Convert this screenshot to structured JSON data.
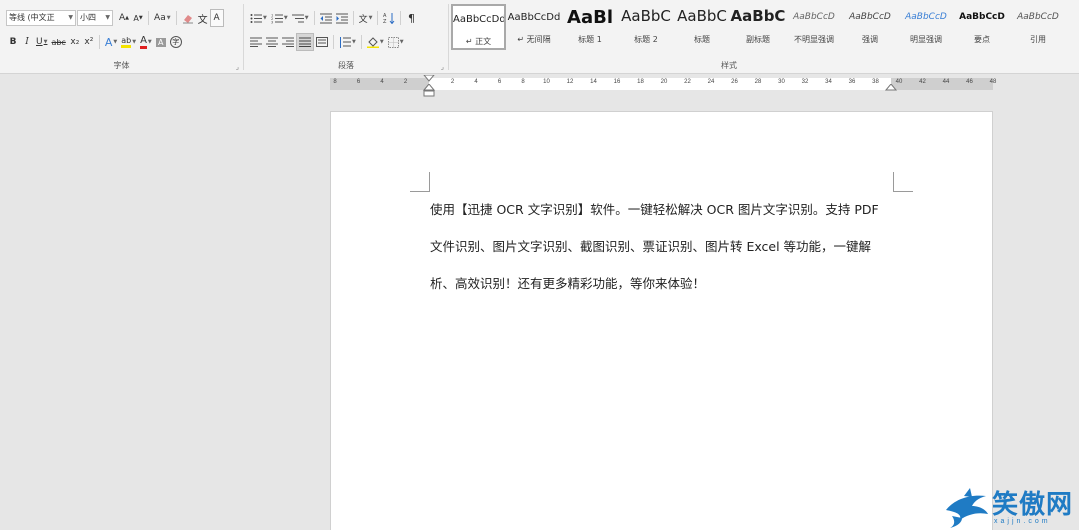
{
  "ribbon": {
    "font_group": {
      "label": "字体",
      "font_name": "等线 (中文正",
      "font_size": "小四",
      "grow_label": "A",
      "shrink_label": "A",
      "case_label": "Aa",
      "bold_label": "B",
      "italic_label": "I",
      "underline_label": "U",
      "strike_label": "abc",
      "subscript_label": "x₂",
      "superscript_label": "x²",
      "text_effect_label": "A",
      "highlight_label": "ab",
      "font_color_label": "A",
      "char_shading_label": "A",
      "enclose_label": "字",
      "phonetic_label": "文",
      "border_label": "A"
    },
    "paragraph_group": {
      "label": "段落"
    },
    "styles_group": {
      "label": "样式",
      "items": [
        {
          "preview": "AaBbCcDd",
          "name": "↵ 正文"
        },
        {
          "preview": "AaBbCcDd",
          "name": "↵ 无间隔"
        },
        {
          "preview": "AaBl",
          "name": "标题 1"
        },
        {
          "preview": "AaBbC",
          "name": "标题 2"
        },
        {
          "preview": "AaBbC",
          "name": "标题"
        },
        {
          "preview": "AaBbC",
          "name": "副标题"
        },
        {
          "preview": "AaBbCcD",
          "name": "不明显强调"
        },
        {
          "preview": "AaBbCcD",
          "name": "强调"
        },
        {
          "preview": "AaBbCcD",
          "name": "明显强调"
        },
        {
          "preview": "AaBbCcD",
          "name": "要点"
        },
        {
          "preview": "AaBbCcD",
          "name": "引用"
        }
      ]
    }
  },
  "ruler": {
    "ticks": [
      "8",
      "6",
      "4",
      "2",
      "2",
      "4",
      "6",
      "8",
      "10",
      "12",
      "14",
      "16",
      "18",
      "20",
      "22",
      "24",
      "26",
      "28",
      "30",
      "32",
      "34",
      "36",
      "38",
      "40",
      "42",
      "44",
      "46",
      "48"
    ]
  },
  "document": {
    "lines": [
      "使用【迅捷 OCR 文字识别】软件。一键轻松解决 OCR 图片文字识别。支持 PDF",
      "文件识别、图片文字识别、截图识别、票证识别、图片转 Excel 等功能，一键解",
      "析、高效识别！还有更多精彩功能，等你来体验！"
    ]
  },
  "watermark": {
    "text": "笑傲网",
    "url": "xajjn.com"
  },
  "colors": {
    "accent": "#1f7bc4",
    "ribbon_bg": "#f3f3f3",
    "workspace_bg": "#e6e6e6",
    "font_color_underline": "#e02020",
    "highlight_yellow": "#f5e400"
  }
}
